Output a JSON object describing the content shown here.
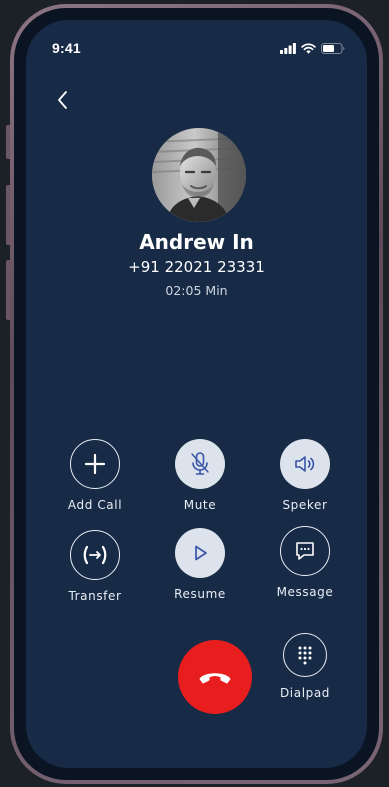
{
  "status_bar": {
    "time": "9:41"
  },
  "caller": {
    "name": "Andrew In",
    "number": "+91 22021 23331",
    "duration": "02:05 Min"
  },
  "controls": {
    "add_call": "Add Call",
    "mute": "Mute",
    "speaker": "Speker",
    "transfer": "Transfer",
    "resume": "Resume",
    "message": "Message",
    "dialpad": "Dialpad"
  },
  "colors": {
    "screen_bg": "#172a46",
    "end_call": "#e81e1e",
    "active_button": "#dde3ec",
    "icon_accent": "#3a55a8"
  },
  "icons": {
    "back": "chevron-left-icon",
    "add_call": "plus-icon",
    "mute": "microphone-icon",
    "speaker": "speaker-icon",
    "transfer": "transfer-icon",
    "resume": "play-icon",
    "message": "chat-icon",
    "dialpad": "dialpad-icon",
    "end_call": "phone-hangup-icon"
  }
}
